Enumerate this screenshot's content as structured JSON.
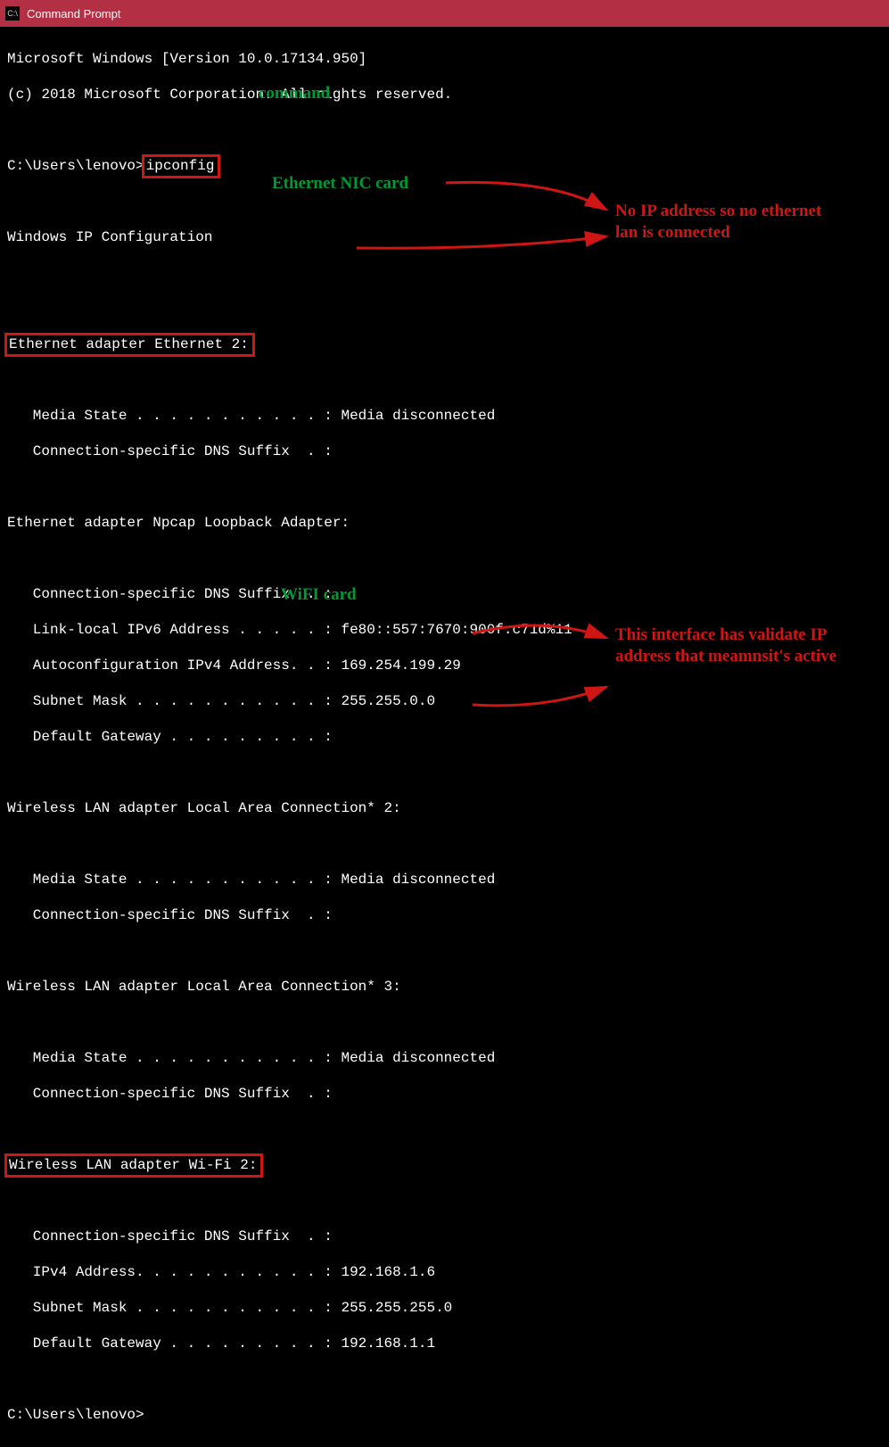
{
  "window": {
    "title": "Command Prompt"
  },
  "header": {
    "line1": "Microsoft Windows [Version 10.0.17134.950]",
    "line2": "(c) 2018 Microsoft Corporation. All rights reserved."
  },
  "prompt1": {
    "prefix": "C:\\Users\\lenovo>",
    "command": "ipconfig"
  },
  "cfg_title": "Windows IP Configuration",
  "adapters": {
    "eth2": {
      "title": "Ethernet adapter Ethernet 2:",
      "media_state": "   Media State . . . . . . . . . . . : Media disconnected",
      "dns": "   Connection-specific DNS Suffix  . :"
    },
    "npcap": {
      "title": "Ethernet adapter Npcap Loopback Adapter:",
      "dns": "   Connection-specific DNS Suffix  . :",
      "ipv6": "   Link-local IPv6 Address . . . . . : fe80::557:7670:900f:c71d%11",
      "auto": "   Autoconfiguration IPv4 Address. . : 169.254.199.29",
      "mask": "   Subnet Mask . . . . . . . . . . . : 255.255.0.0",
      "gw": "   Default Gateway . . . . . . . . . :"
    },
    "lac2": {
      "title": "Wireless LAN adapter Local Area Connection* 2:",
      "media_state": "   Media State . . . . . . . . . . . : Media disconnected",
      "dns": "   Connection-specific DNS Suffix  . :"
    },
    "lac3": {
      "title": "Wireless LAN adapter Local Area Connection* 3:",
      "media_state": "   Media State . . . . . . . . . . . : Media disconnected",
      "dns": "   Connection-specific DNS Suffix  . :"
    },
    "wifi2": {
      "title": "Wireless LAN adapter Wi-Fi 2:",
      "dns": "   Connection-specific DNS Suffix  . :",
      "ipv4": "   IPv4 Address. . . . . . . . . . . : 192.168.1.6",
      "mask": "   Subnet Mask . . . . . . . . . . . : 255.255.255.0",
      "gw": "   Default Gateway . . . . . . . . . : 192.168.1.1"
    }
  },
  "prompt2": {
    "text": "C:\\Users\\lenovo>"
  },
  "annotations": {
    "command": "command",
    "eth_nic": "Ethernet NIC card",
    "no_ip": "No IP address so no ethernet lan is connected",
    "wifi_card": "WiFI card",
    "valid_ip": "This interface has validate IP address that meamnsit's active"
  }
}
